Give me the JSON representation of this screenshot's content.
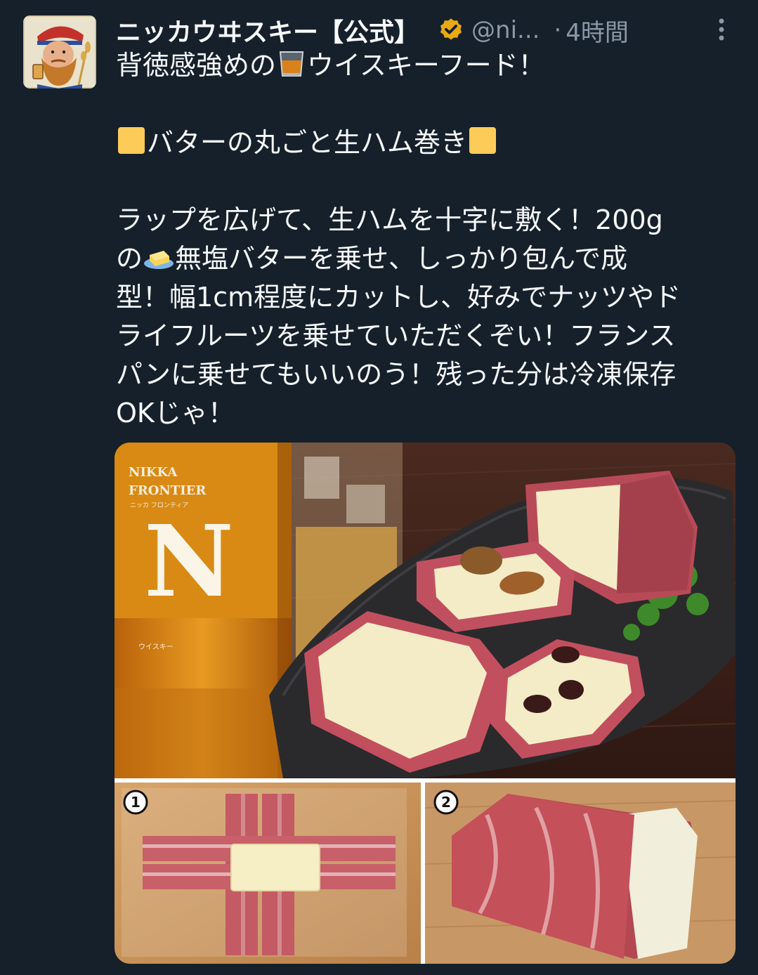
{
  "tweet": {
    "author": {
      "display_name": "ニッカウヰスキー【公式】",
      "handle": "@ni...",
      "verified": true,
      "verified_badge_color": "#f4b400"
    },
    "time_separator": "·",
    "time": "4時間",
    "more_icon": "three-dots-vertical-icon",
    "text": {
      "line1_before": "背徳感強めの",
      "line1_emoji": "tumbler-glass-emoji",
      "line1_after": "ウイスキーフード！",
      "heading": "バターの丸ごと生ハム巻き",
      "heading_emoji": "yellow-square-emoji",
      "p1": "ラップを広げて、生ハムを十字に敷く！200g",
      "p2_prefix": "の",
      "p2_emoji": "butter-emoji",
      "p2_rest": "無塩バターを乗せ、しっかり包んで成",
      "p3": "型！幅1cm程度にカットし、好みでナッツやド",
      "p4": "ライフルーツを乗せていただくぞい！フランス",
      "p5": "パンに乗せてもいいのう！残った分は冷凍保存",
      "p6": "OKじゃ！"
    },
    "media": {
      "bottle_brand": "NIKKA",
      "bottle_name": "FRONTIER",
      "bottle_kana": "ニッカ フロンティア",
      "bottle_letter": "N",
      "bottle_type": "ウイスキー",
      "step1_label": "1",
      "step2_label": "2"
    }
  },
  "colors": {
    "background": "#15202b",
    "text_primary": "#f7f9f9",
    "text_secondary": "#8b98a5",
    "whisky_amber": "#d98a14",
    "ham": "#c05060",
    "butter": "#f3ecc4"
  }
}
